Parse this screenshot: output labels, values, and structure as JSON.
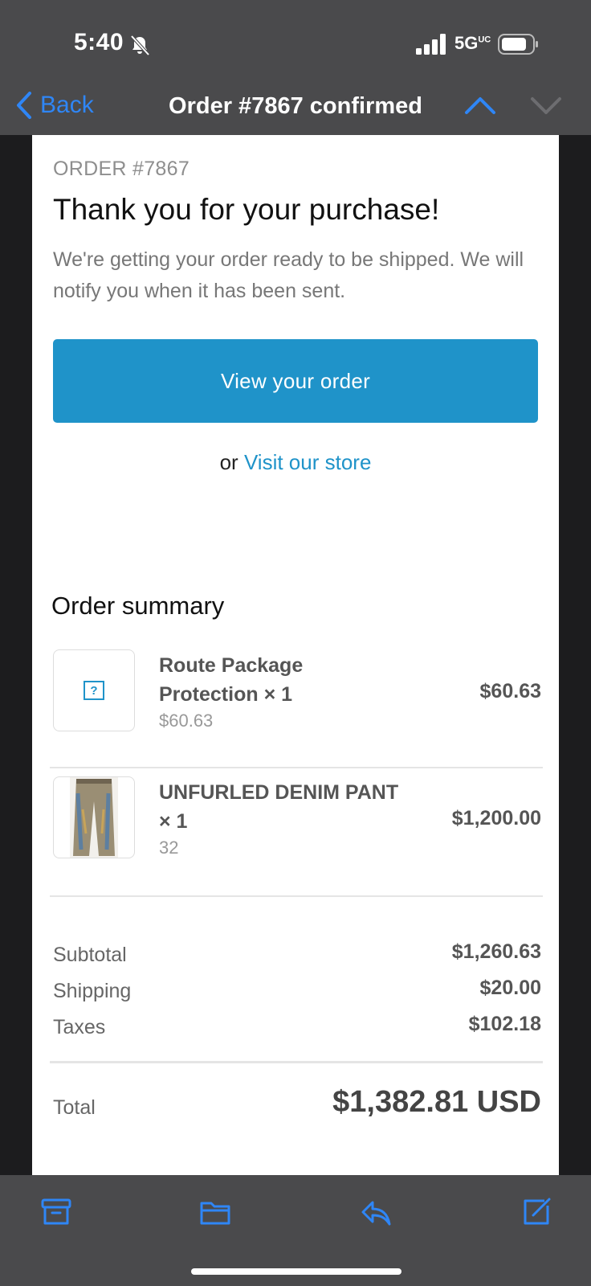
{
  "status_bar": {
    "time": "5:40",
    "network": "5G",
    "network_suffix": "UC",
    "icons": [
      "bell-slash-icon",
      "signal-icon",
      "battery-icon"
    ]
  },
  "nav": {
    "back_label": "Back",
    "title": "Order #7867 confirmed",
    "accent_color": "#2f86f6"
  },
  "email": {
    "order_label": "ORDER #7867",
    "heading": "Thank you for your purchase!",
    "message": "We're getting your order ready to be shipped. We will notify you when it has been sent.",
    "view_button": "View your order",
    "or_text": "or",
    "store_link": "Visit our store",
    "button_color": "#1f93c9",
    "summary_title": "Order summary",
    "items": [
      {
        "name": "Route Package Protection × 1",
        "sub": "$60.63",
        "price": "$60.63",
        "thumb_icon": "missing-image-icon"
      },
      {
        "name": "UNFURLED DENIM PANT × 1",
        "sub": "32",
        "price": "$1,200.00",
        "thumb_icon": "denim-pant-image"
      }
    ],
    "totals": [
      {
        "label": "Subtotal",
        "value": "$1,260.63"
      },
      {
        "label": "Shipping",
        "value": "$20.00"
      },
      {
        "label": "Taxes",
        "value": "$102.18"
      }
    ],
    "total": {
      "label": "Total",
      "value": "$1,382.81 USD"
    }
  },
  "toolbar": {
    "icons": [
      "archive-icon",
      "folder-icon",
      "reply-icon",
      "compose-icon"
    ]
  }
}
